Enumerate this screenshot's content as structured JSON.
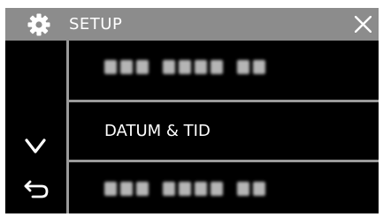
{
  "header": {
    "icon": "gear-icon",
    "title": "SETUP",
    "close_icon": "close-icon"
  },
  "side_panel": {
    "scroll_down_icon": "chevron-down-icon",
    "back_icon": "return-arrow-icon"
  },
  "menu": {
    "items": [
      {
        "label": "",
        "masked": true
      },
      {
        "label": "DATUM & TID",
        "masked": false
      },
      {
        "label": "",
        "masked": true
      }
    ]
  },
  "colors": {
    "header_bg": "#8c8c8c",
    "screen_bg": "#000000",
    "divider": "#9a9a9a",
    "text": "#ffffff"
  }
}
